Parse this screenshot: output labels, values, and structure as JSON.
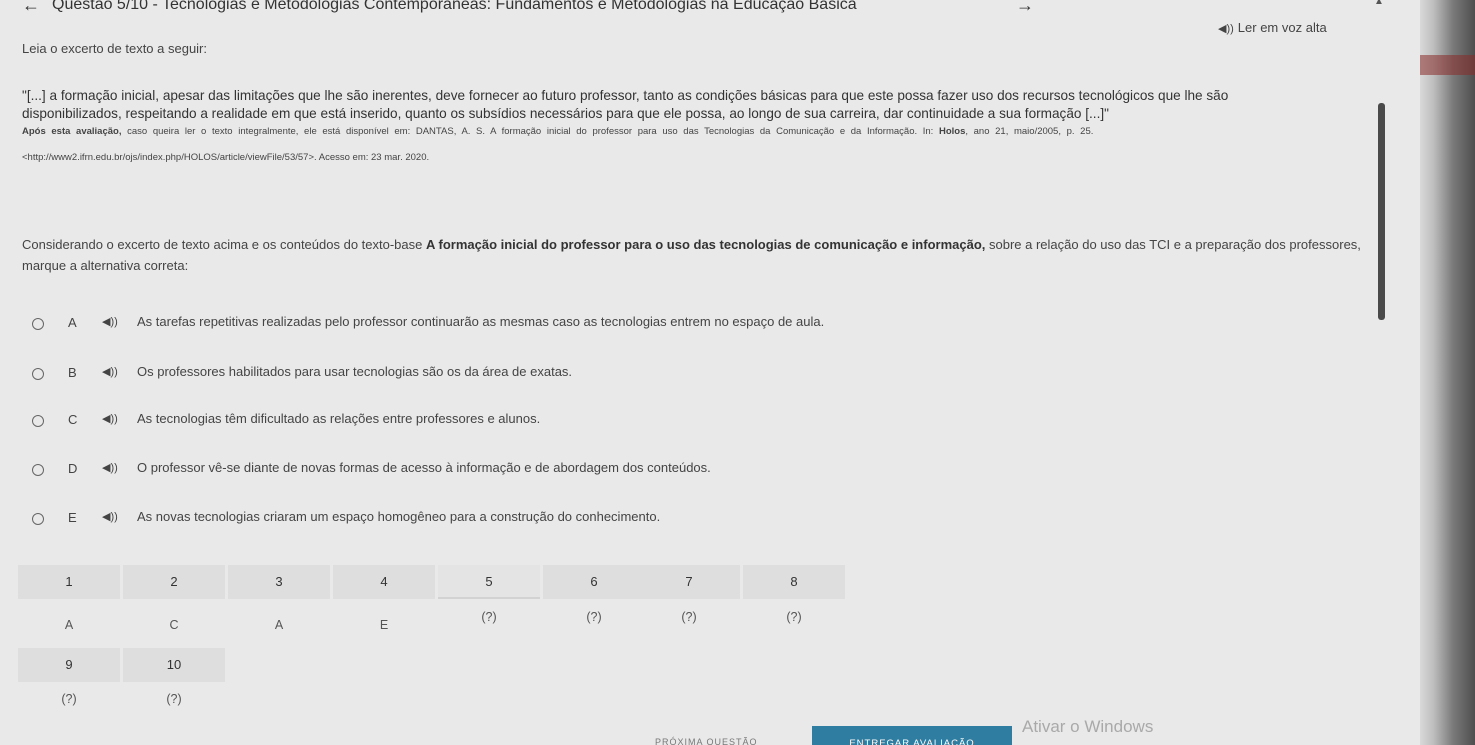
{
  "header": {
    "back_icon": "←",
    "title": "Questão 5/10 - Tecnologias e Metodologias Contemporâneas: Fundamentos e Metodologias na Educação Básica",
    "forward_icon": "→"
  },
  "read_aloud": {
    "icon": "◀))",
    "label": "Ler em voz alta"
  },
  "intro": "Leia o excerto de texto a seguir:",
  "quote": {
    "line1": "\"[...] a formação inicial, apesar das limitações que lhe são inerentes, deve fornecer ao futuro professor, tanto as condições básicas para que este possa fazer uso dos recursos tecnológicos que lhe são",
    "line2": "disponibilizados, respeitando a realidade em que está inserido, quanto os subsídios necessários para que ele possa, ao longo de sua carreira, dar continuidade a sua formação [...]\""
  },
  "source": {
    "prefix": "Após esta avaliação,",
    "text": "caso queira ler o texto integralmente, ele está disponível em: DANTAS, A. S. A formação inicial do professor para uso das Tecnologias da Comunicação e da Informação. In:",
    "journal": "Holos",
    "suffix": ", ano 21, maio/2005, p. 25.",
    "url_line": "<http://www2.ifrn.edu.br/ojs/index.php/HOLOS/article/viewFile/53/57>. Acesso em: 23 mar. 2020."
  },
  "question": {
    "before": "Considerando o excerto de texto acima e os conteúdos do texto-base ",
    "bold": "A formação inicial do professor para o uso das tecnologias de comunicação e informação,",
    "after": " sobre a relação do uso das TCI e a preparação dos professores, marque a alternativa correta:"
  },
  "options": [
    {
      "letter": "A",
      "text": "As tarefas repetitivas realizadas pelo professor continuarão as mesmas caso as tecnologias entrem no espaço de aula."
    },
    {
      "letter": "B",
      "text": "Os professores habilitados para usar tecnologias são os da área de exatas."
    },
    {
      "letter": "C",
      "text": "As tecnologias têm dificultado as relações entre professores e alunos."
    },
    {
      "letter": "D",
      "text": "O professor vê-se diante de novas formas de acesso à informação e de abordagem dos conteúdos."
    },
    {
      "letter": "E",
      "text": "As novas tecnologias criaram um espaço homogêneo para a construção do conhecimento."
    }
  ],
  "option_speaker_icon": "◀))",
  "nav": [
    {
      "num": "1",
      "ans": "A"
    },
    {
      "num": "2",
      "ans": "C"
    },
    {
      "num": "3",
      "ans": "A"
    },
    {
      "num": "4",
      "ans": "E"
    },
    {
      "num": "5",
      "ans": "(?)"
    },
    {
      "num": "6",
      "ans": "(?)"
    },
    {
      "num": "7",
      "ans": "(?)"
    },
    {
      "num": "8",
      "ans": "(?)"
    },
    {
      "num": "9",
      "ans": "(?)"
    },
    {
      "num": "10",
      "ans": "(?)"
    }
  ],
  "bottom": {
    "next_label": "PRÓXIMA QUESTÃO",
    "submit_label": "ENTREGAR AVALIAÇÃO",
    "watermark": "Ativar o Windows"
  },
  "colors": {
    "submit_bg": "#2f7ea1",
    "page_bg": "#e9e9e9"
  }
}
